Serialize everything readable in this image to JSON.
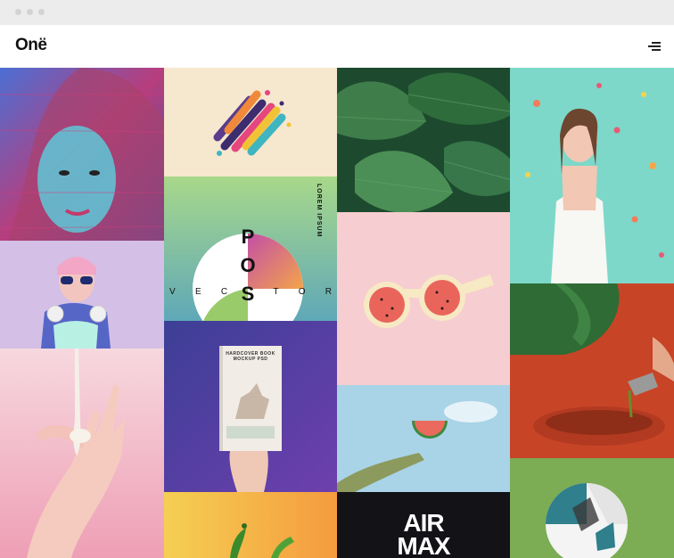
{
  "window": {
    "controls": [
      "close",
      "minimize",
      "maximize"
    ]
  },
  "header": {
    "logo": "Onë",
    "menu_icon": "hamburger-menu-icon"
  },
  "portfolio": {
    "tiles": [
      {
        "id": "portrait-glitch",
        "caption": ""
      },
      {
        "id": "confetti-3d-art",
        "caption": ""
      },
      {
        "id": "tropical-leaves",
        "caption": ""
      },
      {
        "id": "confetti-portrait",
        "caption": ""
      },
      {
        "id": "poster-vector",
        "caption": "POSTER VECTOR",
        "vertical_text": "LOREM IPSUM",
        "letters_vertical": [
          "P",
          "O",
          "S"
        ],
        "letters_horizontal": [
          "V",
          "E",
          "C",
          "S",
          "T",
          "O",
          "R"
        ]
      },
      {
        "id": "pastel-portrait",
        "caption": ""
      },
      {
        "id": "watermelon-glasses",
        "caption": ""
      },
      {
        "id": "hand-paint",
        "caption": ""
      },
      {
        "id": "hardcover-book-mockup",
        "caption": "",
        "book_text": "HARDCOVER BOOK MOCKUP PSD"
      },
      {
        "id": "cocktail-pour",
        "caption": ""
      },
      {
        "id": "watermelon-sky",
        "caption": ""
      },
      {
        "id": "chili-peppers",
        "caption": ""
      },
      {
        "id": "air-max",
        "caption": "",
        "text_line1": "AIR",
        "text_line2": "MAX"
      },
      {
        "id": "3d-helmet",
        "caption": ""
      }
    ]
  }
}
